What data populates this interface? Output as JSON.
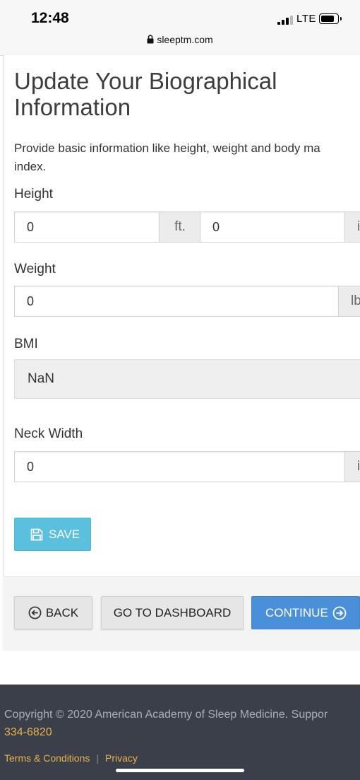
{
  "status_bar": {
    "time": "12:48",
    "network": "LTE",
    "url": "sleeptm.com"
  },
  "page": {
    "title": "Update Your Biographical Information",
    "description_line1": "Provide basic information like height, weight and body ma",
    "description_line2": "index."
  },
  "form": {
    "height": {
      "label": "Height",
      "feet_value": "0",
      "feet_unit": "ft.",
      "inches_value": "0",
      "inches_unit": "i"
    },
    "weight": {
      "label": "Weight",
      "value": "0",
      "unit": "lb"
    },
    "bmi": {
      "label": "BMI",
      "value": "NaN"
    },
    "neck_width": {
      "label": "Neck Width",
      "value": "0",
      "unit": "i"
    },
    "save_label": "SAVE"
  },
  "navigation": {
    "back_label": "BACK",
    "dashboard_label": "GO TO DASHBOARD",
    "continue_label": "CONTINUE"
  },
  "footer": {
    "copyright": "Copyright © 2020 American Academy of Sleep Medicine. Suppor",
    "phone": "334-6820",
    "terms_label": "Terms & Conditions",
    "separator": "|",
    "privacy_label": "Privacy"
  },
  "colors": {
    "save_button": "#5bc0de",
    "continue_button": "#4a90d9",
    "footer_background": "#3a3f49",
    "footer_link": "#e6b34a"
  }
}
